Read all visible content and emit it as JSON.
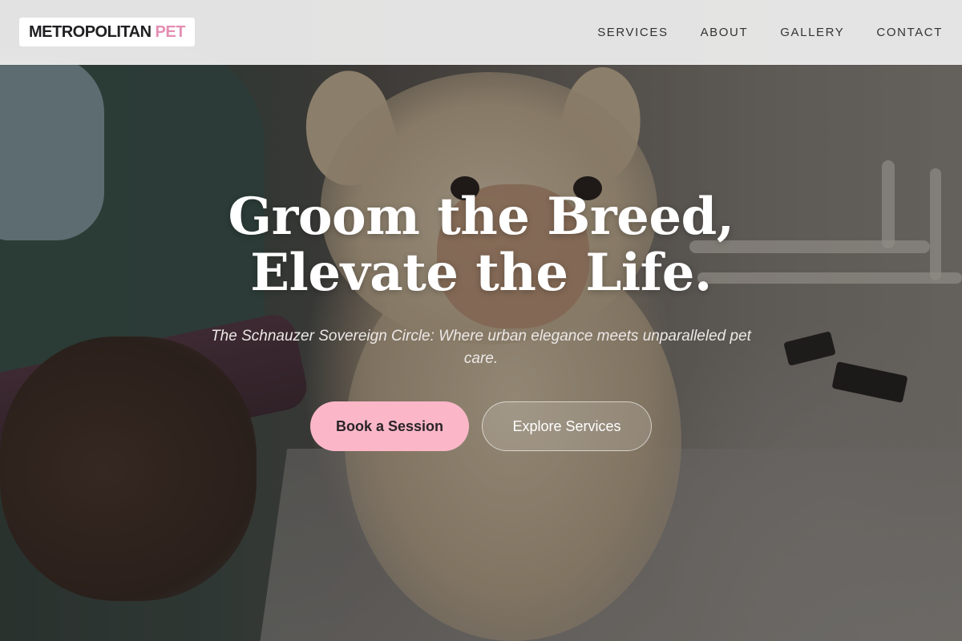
{
  "logo": {
    "main": "METROPOLITAN",
    "accent": "PET"
  },
  "nav": {
    "items": [
      {
        "label": "SERVICES"
      },
      {
        "label": "ABOUT"
      },
      {
        "label": "GALLERY"
      },
      {
        "label": "CONTACT"
      }
    ]
  },
  "hero": {
    "headline_line1": "Groom the Breed,",
    "headline_line2": "Elevate the Life.",
    "subtitle": "The Schnauzer Sovereign Circle: Where urban elegance meets unparalleled pet care.",
    "primary_cta": "Book a Session",
    "secondary_cta": "Explore Services"
  },
  "colors": {
    "accent_pink": "#fbb7c8",
    "logo_accent": "#e38fb3",
    "nav_background": "#e8e8e8"
  }
}
